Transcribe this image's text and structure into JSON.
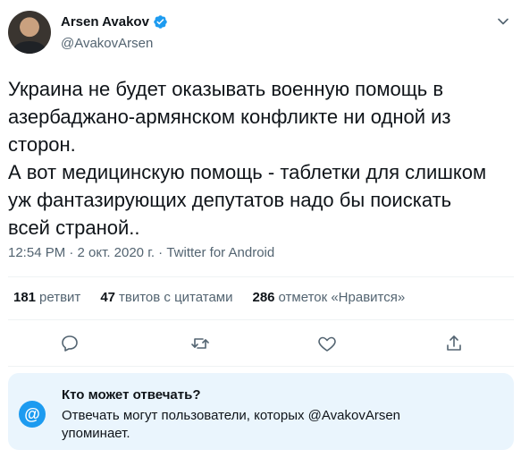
{
  "author": {
    "name": "Arsen Avakov",
    "handle": "@AvakovArsen"
  },
  "tweet": {
    "text": "Украина не будет оказывать военную помощь в\nазербаджано-армянском конфликте ни одной из\nсторон.\nА вот медицинскую помощь - таблетки для слишком\nуж фантазирующих депутатов надо бы поискать\nвсей страной..",
    "time": "12:54 PM · 2 окт. 2020 г. · Twitter for Android"
  },
  "stats": [
    {
      "num": "181",
      "label": "ретвит"
    },
    {
      "num": "47",
      "label": "твитов с цитатами"
    },
    {
      "num": "286",
      "label": "отметок «Нравится»"
    }
  ],
  "actions": {
    "icons": [
      "reply-icon",
      "retweet-icon",
      "like-icon",
      "share-icon"
    ]
  },
  "reply_restriction": {
    "title": "Кто может отвечать?",
    "description": "Отвечать могут пользователи, которых @AvakovArsen упоминает.",
    "icon_symbol": "@"
  },
  "colors": {
    "accent": "#1d9bf0",
    "muted": "#536471",
    "reply_box_bg": "#eaf5fd"
  }
}
